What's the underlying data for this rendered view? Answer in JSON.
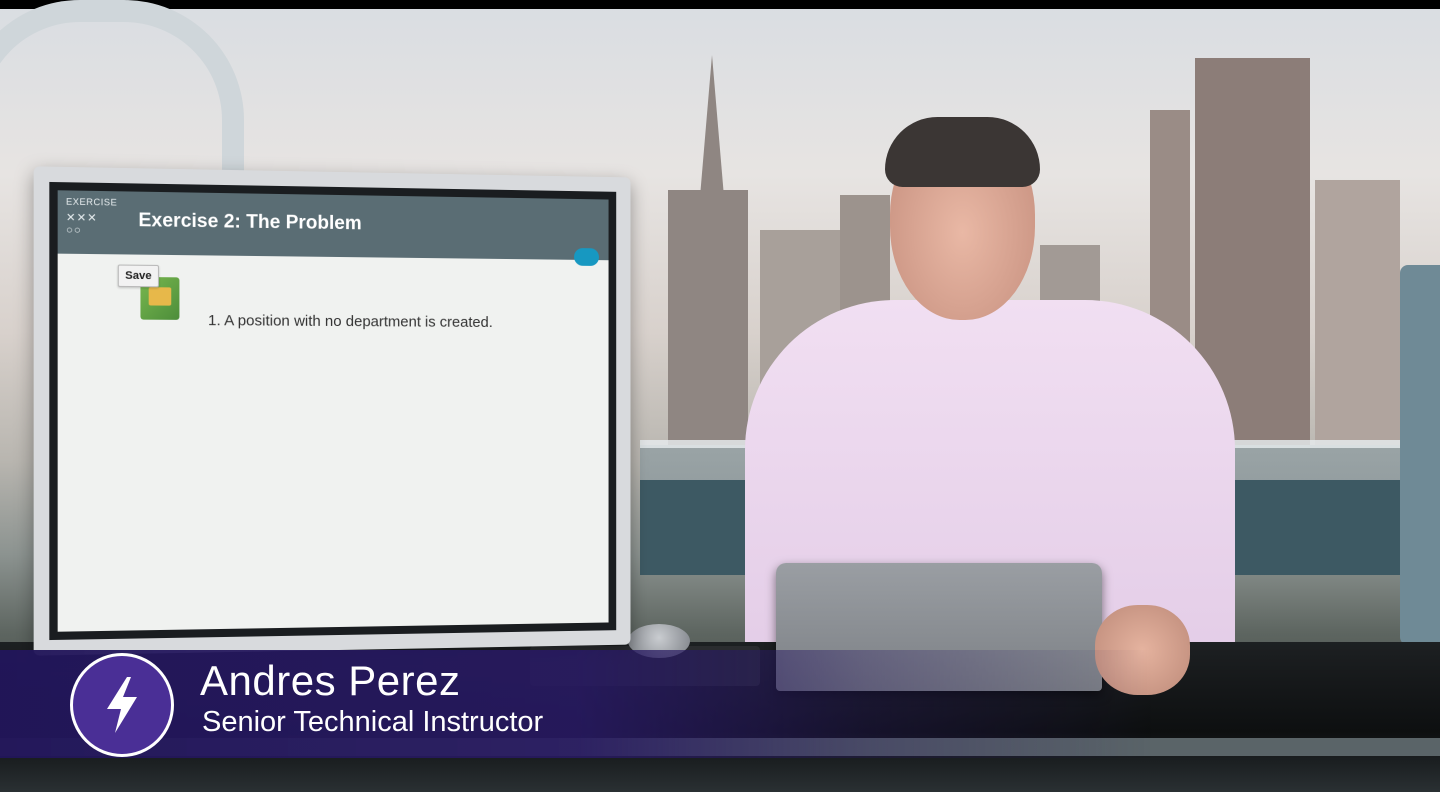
{
  "slide": {
    "badge_label": "EXERCISE",
    "title": "Exercise 2: The Problem",
    "save_label": "Save",
    "items": [
      "1.  A position with no department is created."
    ]
  },
  "lower_third": {
    "name": "Andres Perez",
    "role": "Senior Technical Instructor",
    "logo_icon": "lightning-bolt-icon"
  },
  "colors": {
    "slide_header": "#5a6d74",
    "lower_third_bg": "#281a62",
    "accent_bolt_circle": "#4a2f96"
  }
}
